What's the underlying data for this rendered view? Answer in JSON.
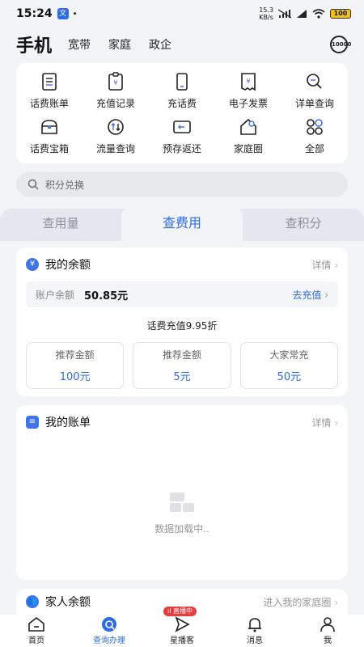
{
  "status": {
    "time": "15:24",
    "notif_icon_label": "文",
    "net_speed_top": "15.3",
    "net_speed_bottom": "KB/s",
    "battery": "100"
  },
  "topnav": {
    "main": "手机",
    "items": [
      "宽带",
      "家庭",
      "政企"
    ],
    "service_label": "10000"
  },
  "grid": [
    {
      "label": "话费账单",
      "icon": "bill-icon"
    },
    {
      "label": "充值记录",
      "icon": "recharge-record-icon"
    },
    {
      "label": "充话费",
      "icon": "phone-recharge-icon"
    },
    {
      "label": "电子发票",
      "icon": "invoice-icon"
    },
    {
      "label": "详单查询",
      "icon": "detail-query-icon"
    },
    {
      "label": "话费宝箱",
      "icon": "treasure-box-icon"
    },
    {
      "label": "流量查询",
      "icon": "data-query-icon"
    },
    {
      "label": "预存返还",
      "icon": "prepay-return-icon"
    },
    {
      "label": "家庭圈",
      "icon": "family-circle-icon"
    },
    {
      "label": "全部",
      "icon": "all-apps-icon"
    }
  ],
  "search": {
    "placeholder": "积分兑换"
  },
  "tabs": [
    {
      "label": "查用量",
      "active": false
    },
    {
      "label": "查费用",
      "active": true
    },
    {
      "label": "查积分",
      "active": false
    }
  ],
  "balance_card": {
    "icon": "¥",
    "title": "我的余额",
    "detail": "详情",
    "account_label": "账户余额",
    "account_value": "50.85元",
    "recharge_link": "去充值",
    "promo": "话费充值9.95折",
    "options": [
      {
        "title": "推荐金额",
        "value": "100元"
      },
      {
        "title": "推荐金额",
        "value": "5元"
      },
      {
        "title": "大家常充",
        "value": "50元"
      }
    ]
  },
  "bill_card": {
    "title": "我的账单",
    "detail": "详情",
    "loading": "数据加载中.."
  },
  "family_card": {
    "title": "家人余额",
    "link": "进入我的家庭圈"
  },
  "live_badge": "直播中",
  "bottomnav": [
    {
      "label": "首页",
      "icon": "home-icon",
      "active": false
    },
    {
      "label": "查询办理",
      "icon": "query-icon",
      "active": true
    },
    {
      "label": "星播客",
      "icon": "star-broadcast-icon",
      "active": false
    },
    {
      "label": "消息",
      "icon": "bell-icon",
      "active": false
    },
    {
      "label": "我",
      "icon": "profile-icon",
      "active": false
    }
  ],
  "colors": {
    "accent": "#2e6be6",
    "badge": "#e83c3c"
  }
}
